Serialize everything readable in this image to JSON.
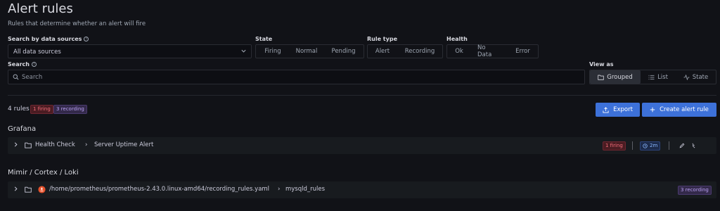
{
  "header": {
    "title": "Alert rules",
    "subtitle": "Rules that determine whether an alert will fire"
  },
  "filters": {
    "datasource": {
      "label": "Search by data sources",
      "value": "All data sources"
    },
    "state": {
      "label": "State",
      "options": [
        "Firing",
        "Normal",
        "Pending"
      ]
    },
    "rule_type": {
      "label": "Rule type",
      "options": [
        "Alert",
        "Recording"
      ]
    },
    "health": {
      "label": "Health",
      "options": [
        "Ok",
        "No Data",
        "Error"
      ]
    },
    "search": {
      "label": "Search",
      "placeholder": "Search",
      "value": ""
    },
    "view_as": {
      "label": "View as",
      "options": [
        "Grouped",
        "List",
        "State"
      ],
      "selected": "Grouped"
    }
  },
  "summary": {
    "count": "4 rules",
    "firing": "1 firing",
    "recording": "3 recording"
  },
  "actions": {
    "export": "Export",
    "create": "Create alert rule"
  },
  "sections": [
    {
      "title": "Grafana",
      "row": {
        "folder": "Health Check",
        "separator": "›",
        "group": "Server Uptime Alert",
        "badge": "1 firing",
        "interval": "2m"
      }
    },
    {
      "title": "Mimir / Cortex / Loki",
      "row": {
        "folder": "/home/prometheus/prometheus-2.43.0.linux-amd64/recording_rules.yaml",
        "separator": "›",
        "group": "mysqld_rules",
        "badge": "3 recording"
      }
    }
  ],
  "colors": {
    "background": "#111217",
    "primary": "#3d71d9",
    "firing": "#f26d7a",
    "recording": "#b9a0f2",
    "prometheus": "#e6522c"
  },
  "icons": [
    "info-icon",
    "chevron-down-icon",
    "search-icon",
    "folder-icon",
    "list-icon",
    "activity-icon",
    "upload-icon",
    "plus-icon",
    "clock-icon",
    "pencil-icon",
    "edit-icon",
    "chevron-right-icon",
    "prometheus-icon"
  ]
}
